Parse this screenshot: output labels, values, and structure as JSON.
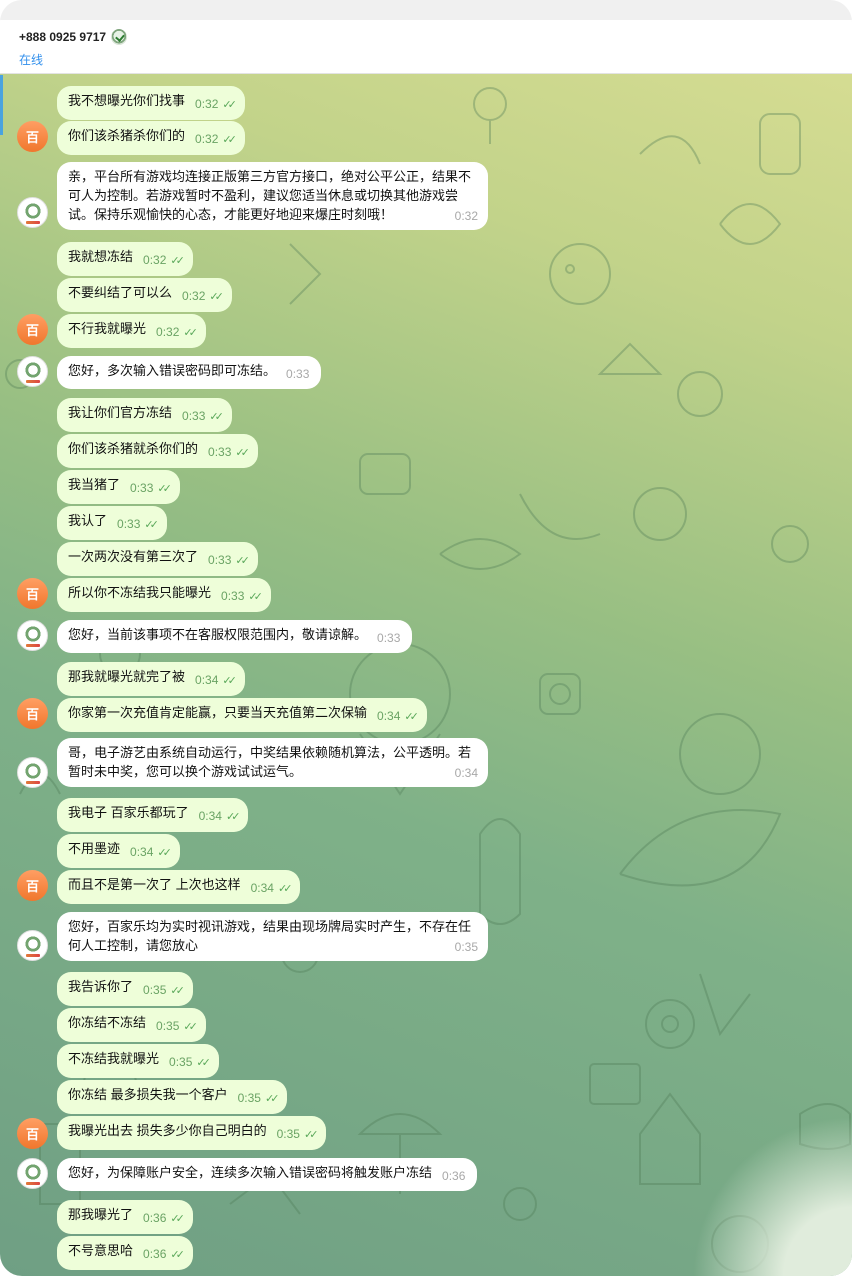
{
  "header": {
    "contact_name": "+888 0925 9717",
    "status": "在线",
    "badge_icon": "verified-emblem-icon"
  },
  "avatars": {
    "user_initial": "百",
    "agent_icon": "company-logo-icon"
  },
  "colors": {
    "outgoing_bubble": "#eefed9",
    "incoming_bubble": "#ffffff",
    "status_text": "#3390ec",
    "user_avatar": "#f0772d",
    "read_ticks": "#5aa85a"
  },
  "messages": [
    {
      "id": "m01",
      "dir": "out",
      "text": "我不想曝光你们找事",
      "time": "0:32"
    },
    {
      "id": "m02",
      "dir": "out",
      "text": "你们该杀猪杀你们的",
      "time": "0:32"
    },
    {
      "id": "m03",
      "dir": "in",
      "text": "亲，平台所有游戏均连接正版第三方官方接口，绝对公平公正，结果不可人为控制。若游戏暂时不盈利，建议您适当休息或切换其他游戏尝试。保持乐观愉快的心态，才能更好地迎来爆庄时刻哦！",
      "time": "0:32"
    },
    {
      "id": "m04",
      "dir": "out",
      "text": "我就想冻结",
      "time": "0:32"
    },
    {
      "id": "m05",
      "dir": "out",
      "text": "不要纠结了可以么",
      "time": "0:32"
    },
    {
      "id": "m06",
      "dir": "out",
      "text": "不行我就曝光",
      "time": "0:32"
    },
    {
      "id": "m07",
      "dir": "in",
      "text": "您好，多次输入错误密码即可冻结。",
      "time": "0:33"
    },
    {
      "id": "m08",
      "dir": "out",
      "text": "我让你们官方冻结",
      "time": "0:33"
    },
    {
      "id": "m09",
      "dir": "out",
      "text": "你们该杀猪就杀你们的",
      "time": "0:33"
    },
    {
      "id": "m10",
      "dir": "out",
      "text": "我当猪了",
      "time": "0:33"
    },
    {
      "id": "m11",
      "dir": "out",
      "text": "我认了",
      "time": "0:33"
    },
    {
      "id": "m12",
      "dir": "out",
      "text": "一次两次没有第三次了",
      "time": "0:33"
    },
    {
      "id": "m13",
      "dir": "out",
      "text": "所以你不冻结我只能曝光",
      "time": "0:33"
    },
    {
      "id": "m14",
      "dir": "in",
      "text": "您好，当前该事项不在客服权限范围内，敬请谅解。",
      "time": "0:33"
    },
    {
      "id": "m15",
      "dir": "out",
      "text": "那我就曝光就完了被",
      "time": "0:34"
    },
    {
      "id": "m16",
      "dir": "out",
      "text": "你家第一次充值肯定能赢，只要当天充值第二次保输",
      "time": "0:34"
    },
    {
      "id": "m17",
      "dir": "in",
      "text": "哥，电子游艺由系统自动运行，中奖结果依赖随机算法，公平透明。若暂时未中奖，您可以换个游戏试试运气。",
      "time": "0:34"
    },
    {
      "id": "m18",
      "dir": "out",
      "text": "我电子 百家乐都玩了",
      "time": "0:34"
    },
    {
      "id": "m19",
      "dir": "out",
      "text": "不用墨迹",
      "time": "0:34"
    },
    {
      "id": "m20",
      "dir": "out",
      "text": "而且不是第一次了 上次也这样",
      "time": "0:34"
    },
    {
      "id": "m21",
      "dir": "in",
      "text": "您好，百家乐均为实时视讯游戏，结果由现场牌局实时产生，不存在任何人工控制，请您放心",
      "time": "0:35"
    },
    {
      "id": "m22",
      "dir": "out",
      "text": "我告诉你了",
      "time": "0:35"
    },
    {
      "id": "m23",
      "dir": "out",
      "text": "你冻结不冻结",
      "time": "0:35"
    },
    {
      "id": "m24",
      "dir": "out",
      "text": "不冻结我就曝光",
      "time": "0:35"
    },
    {
      "id": "m25",
      "dir": "out",
      "text": "你冻结 最多损失我一个客户",
      "time": "0:35"
    },
    {
      "id": "m26",
      "dir": "out",
      "text": "我曝光出去 损失多少你自己明白的",
      "time": "0:35"
    },
    {
      "id": "m27",
      "dir": "in",
      "text": "您好，为保障账户安全，连续多次输入错误密码将触发账户冻结",
      "time": "0:36"
    },
    {
      "id": "m28",
      "dir": "out",
      "text": "那我曝光了",
      "time": "0:36"
    },
    {
      "id": "m29",
      "dir": "out",
      "text": "不号意思哈",
      "time": "0:36"
    }
  ]
}
